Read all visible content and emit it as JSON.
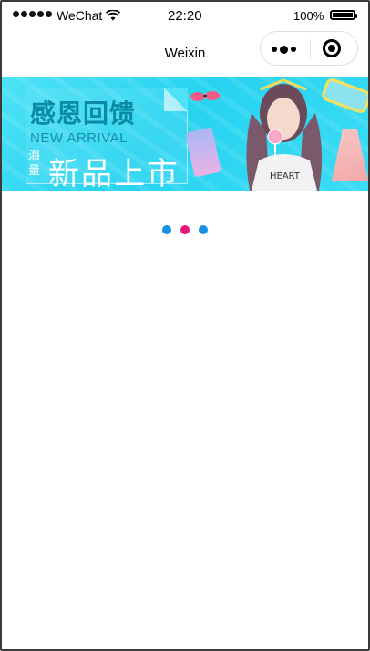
{
  "status_bar": {
    "carrier": "WeChat",
    "time": "22:20",
    "battery_percent": "100%",
    "battery_level": 1.0
  },
  "nav": {
    "title": "Weixin",
    "more_icon": "more-dots-icon",
    "close_icon": "close-circle-icon"
  },
  "banner": {
    "title": "感恩回馈",
    "subtitle": "NEW ARRIVAL",
    "side_text": "海量",
    "headline": "新品上市",
    "colors": {
      "background": "#27d3f0",
      "title": "#0b8aa3"
    }
  },
  "loading": {
    "colors": [
      "#1a8fe6",
      "#e6177d",
      "#1a8fe6"
    ]
  }
}
